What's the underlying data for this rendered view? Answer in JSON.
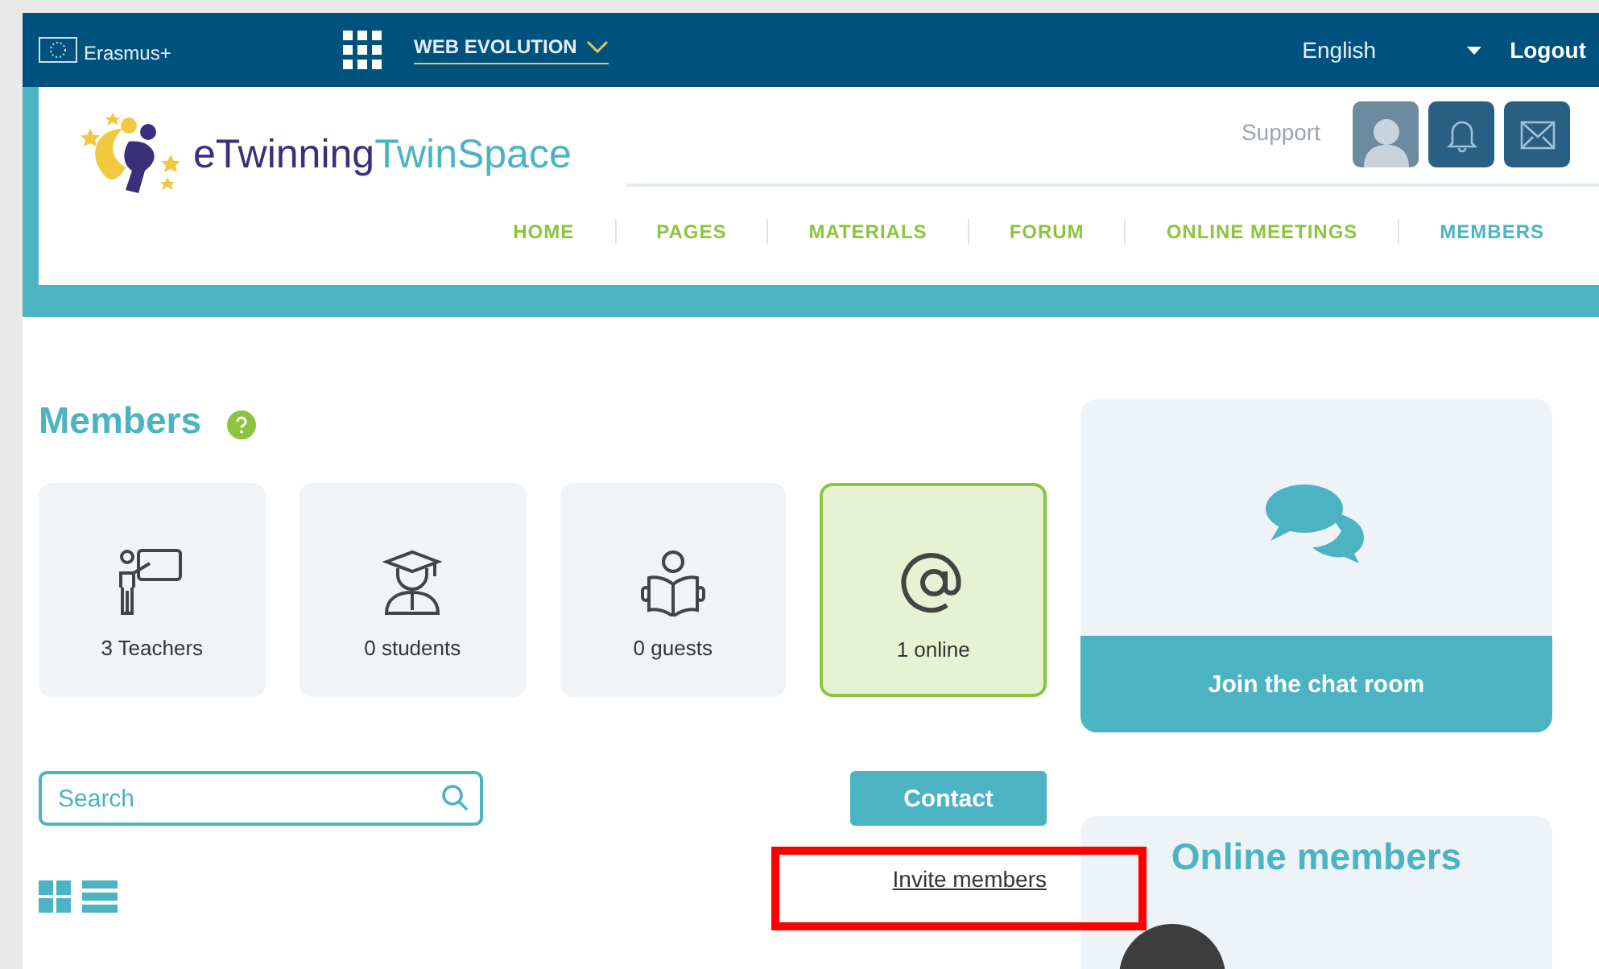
{
  "top_bar": {
    "brand": "Erasmus+",
    "project": "WEB EVOLUTION",
    "language": "English",
    "logout": "Logout"
  },
  "header": {
    "logo_text_dark": "eTwinning",
    "logo_text_light": "TwinSpace",
    "support": "Support",
    "nav": [
      {
        "label": "HOME",
        "selected": false
      },
      {
        "label": "PAGES",
        "selected": false
      },
      {
        "label": "MATERIALS",
        "selected": false
      },
      {
        "label": "FORUM",
        "selected": false
      },
      {
        "label": "ONLINE MEETINGS",
        "selected": false
      },
      {
        "label": "MEMBERS",
        "selected": true
      }
    ]
  },
  "members": {
    "title": "Members",
    "cards": [
      {
        "kind": "teacher",
        "label": "3 Teachers",
        "selected": false
      },
      {
        "kind": "student",
        "label": "0 students",
        "selected": false
      },
      {
        "kind": "guest",
        "label": "0 guests",
        "selected": false
      },
      {
        "kind": "online",
        "label": "1 online",
        "selected": true
      }
    ],
    "search": {
      "placeholder": "Search"
    },
    "contact": "Contact",
    "invite": "Invite members"
  },
  "chat": {
    "button": "Join the chat room"
  },
  "online_members": {
    "title": "Online members"
  }
}
